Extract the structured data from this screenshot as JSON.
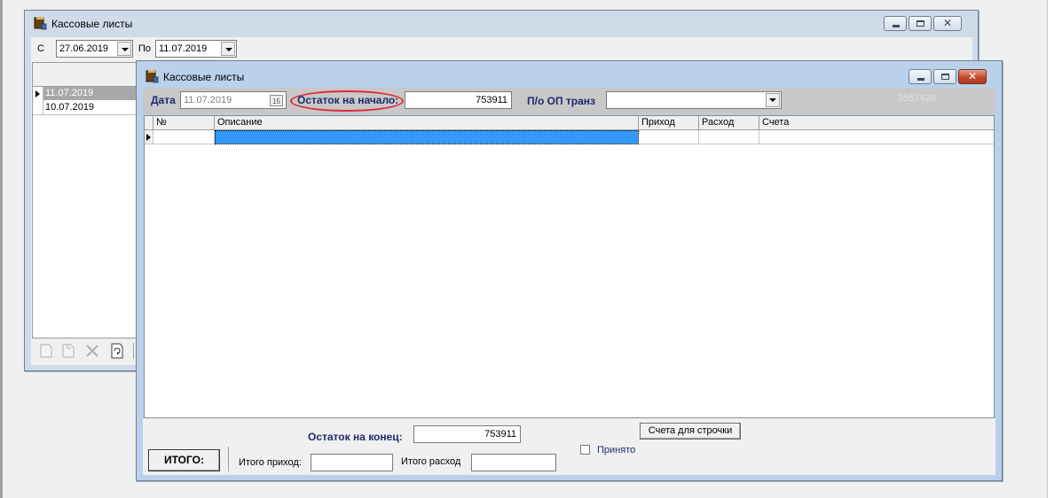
{
  "back_window": {
    "title": "Кассовые листы",
    "filter": {
      "from_label": "С",
      "from_date": "27.06.2019",
      "to_label": "По",
      "to_date": "11.07.2019"
    },
    "dates": [
      "11.07.2019",
      "10.07.2019"
    ],
    "selected_index": 0
  },
  "front_window": {
    "title": "Кассовые листы",
    "date_label": "Дата",
    "date_value": "11.07.2019",
    "opening_balance_label": "Остаток на начало:",
    "opening_balance_value": "753911",
    "transit_label": "П/о ОП транз",
    "transit_value": "",
    "faded_number": "3557426",
    "grid": {
      "columns": [
        "№",
        "Описание",
        "Приход",
        "Расход",
        "Счета"
      ]
    },
    "closing_balance_label": "Остаток на конец:",
    "closing_balance_value": "753911",
    "accounts_button": "Счета для строчки",
    "accepted_label": "Принято",
    "accepted_checked": false,
    "total_button": "ИТОГО:",
    "total_income_label": "Итого приход:",
    "total_income_value": "",
    "total_expense_label": "Итого расход",
    "total_expense_value": ""
  },
  "colors": {
    "title_inactive": "#cfdbe8",
    "title_active": "#b9d1ea",
    "selection": "#3399ff",
    "label_blue": "#1c2a6e",
    "highlight_ellipse": "#e0283c"
  }
}
